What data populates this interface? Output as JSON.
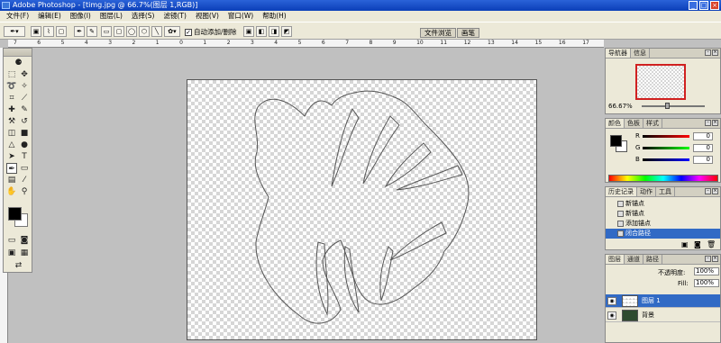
{
  "titlebar": {
    "title": "Adobe Photoshop - [timg.jpg @ 66.7%(图层 1,RGB)]"
  },
  "menu": [
    "文件(F)",
    "编辑(E)",
    "图像(I)",
    "图层(L)",
    "选择(S)",
    "滤镜(T)",
    "视图(V)",
    "窗口(W)",
    "帮助(H)"
  ],
  "options": {
    "auto_add_delete_label": "自动添加/删除",
    "auto_add_delete_checked": "✓",
    "wells": [
      "文件浏览",
      "画笔"
    ]
  },
  "ruler": {
    "ticks": [
      "7",
      "6",
      "5",
      "4",
      "3",
      "2",
      "1",
      "0",
      "1",
      "2",
      "3",
      "4",
      "5",
      "6",
      "7",
      "8",
      "9",
      "10",
      "11",
      "12",
      "13",
      "14",
      "15",
      "16",
      "17"
    ]
  },
  "navigator": {
    "tabs": [
      "导航器",
      "信息"
    ],
    "zoom": "66.67%"
  },
  "color": {
    "tabs": [
      "颜色",
      "色板",
      "样式"
    ],
    "channels": [
      {
        "label": "R",
        "value": "0"
      },
      {
        "label": "G",
        "value": "0"
      },
      {
        "label": "B",
        "value": "0"
      }
    ]
  },
  "history": {
    "tabs": [
      "历史记录",
      "动作",
      "工具"
    ],
    "items": [
      "新锚点",
      "新锚点",
      "添加锚点",
      "闭合路径"
    ]
  },
  "layers": {
    "tabs": [
      "图层",
      "通道",
      "路径"
    ],
    "opacity_label": "不透明度:",
    "opacity_value": "100%",
    "fill_label": "Fill:",
    "fill_value": "100%",
    "rows": [
      {
        "name": "图层 1"
      },
      {
        "name": "背景"
      }
    ]
  }
}
